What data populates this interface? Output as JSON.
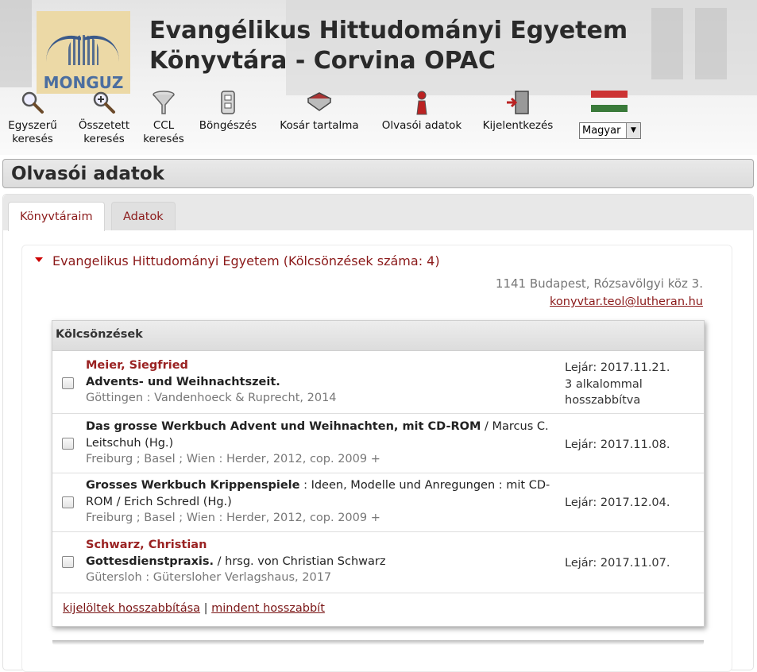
{
  "header": {
    "logo_text": "MONGUZ",
    "title_line1": "Evangélikus Hittudományi Egyetem",
    "title_line2": "Könyvtára - Corvina OPAC"
  },
  "toolbar": {
    "simple_search": "Egyszerű\nkeresés",
    "advanced_search": "Összetett\nkeresés",
    "ccl_search": "CCL\nkeresés",
    "browse": "Böngészés",
    "cart": "Kosár tartalma",
    "reader_data": "Olvasói adatok",
    "logout": "Kijelentkezés",
    "language": "Magyar"
  },
  "page": {
    "title": "Olvasói adatok"
  },
  "tabs": [
    {
      "label": "Könyvtáraim",
      "active": true
    },
    {
      "label": "Adatok",
      "active": false
    }
  ],
  "library": {
    "heading": "Evangelikus Hittudományi Egyetem (Kölcsönzések száma: 4)",
    "address": "1141 Budapest, Rózsavölgyi köz 3.",
    "email": "konyvtar.teol@lutheran.hu"
  },
  "loans": {
    "title": "Kölcsönzések",
    "items": [
      {
        "author": "Meier, Siegfried",
        "title_bold": "Advents- und Weihnachtszeit.",
        "title_rest": "",
        "publication": "Göttingen : Vandenhoeck & Ruprecht, 2014",
        "due": "Lejár: 2017.11.21.",
        "renewals": "3 alkalommal hosszabbítva"
      },
      {
        "author": "",
        "title_bold": "Das grosse Werkbuch Advent und Weihnachten, mit CD-ROM",
        "title_rest": "  /  Marcus C. Leitschuh (Hg.)",
        "publication": "Freiburg ; Basel ; Wien : Herder, 2012, cop. 2009 +",
        "due": "Lejár: 2017.11.08.",
        "renewals": ""
      },
      {
        "author": "",
        "title_bold": "Grosses Werkbuch Krippenspiele",
        "title_rest": "  :  Ideen, Modelle und Anregungen : mit CD-ROM  /  Erich Schredl (Hg.)",
        "publication": "Freiburg ; Basel ; Wien : Herder, 2012, cop. 2009 +",
        "due": "Lejár: 2017.12.04.",
        "renewals": ""
      },
      {
        "author": "Schwarz, Christian",
        "title_bold": "Gottesdienstpraxis.",
        "title_rest": "  /  hrsg. von Christian Schwarz",
        "publication": "Gütersloh : Gütersloher Verlagshaus, 2017",
        "due": "Lejár: 2017.11.07.",
        "renewals": ""
      }
    ],
    "renew_selected": "kijelöltek hosszabbítása",
    "separator": "|",
    "renew_all": "mindent hosszabbít"
  }
}
